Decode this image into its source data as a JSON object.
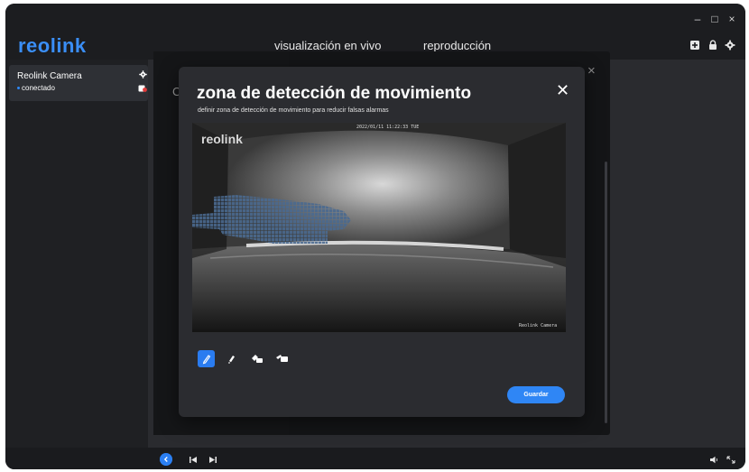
{
  "app": {
    "brand": "reolink",
    "title": "Reolink"
  },
  "nav": {
    "live": "visualización en vivo",
    "playback": "reproducción"
  },
  "window_controls": {
    "minimize": "–",
    "maximize": "□",
    "close": "×"
  },
  "toolbar_icons": [
    "add-device-icon",
    "lock-icon",
    "gear-icon"
  ],
  "sidebar": {
    "camera": {
      "name": "Reolink Camera",
      "status": "conectado"
    }
  },
  "settings_panel": {
    "partial_title": "C",
    "close": "×"
  },
  "modal": {
    "title": "zona de detección de movimiento",
    "subtitle": "definir zona de detección de movimiento para reducir falsas alarmas",
    "close": "✕",
    "video": {
      "timestamp": "2022/01/11 11:22:33 TUE",
      "logo": "reolink",
      "camera_label": "Reolink Camera"
    },
    "tools": [
      "pencil-icon",
      "eraser-icon",
      "clear-all-icon",
      "select-all-icon"
    ],
    "save_label": "Guardar"
  },
  "colors": {
    "accent": "#2f86f5",
    "background": "#1e1f22",
    "modal": "#2b2c30"
  }
}
